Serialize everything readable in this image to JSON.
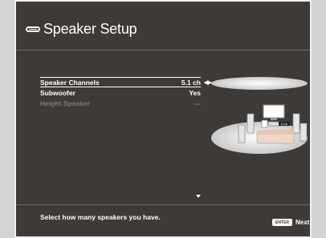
{
  "title": "Speaker Setup",
  "menu": {
    "items": [
      {
        "label": "Speaker Channels",
        "value": "5.1 ch"
      },
      {
        "label": "Subwoofer",
        "value": "Yes"
      },
      {
        "label": "Height Speaker",
        "value": "---"
      }
    ]
  },
  "diagram": {
    "display_label": "5.1ch"
  },
  "footer": {
    "help": "Select how many speakers you have.",
    "enter_label": "ENTER",
    "next_label": "Next"
  }
}
